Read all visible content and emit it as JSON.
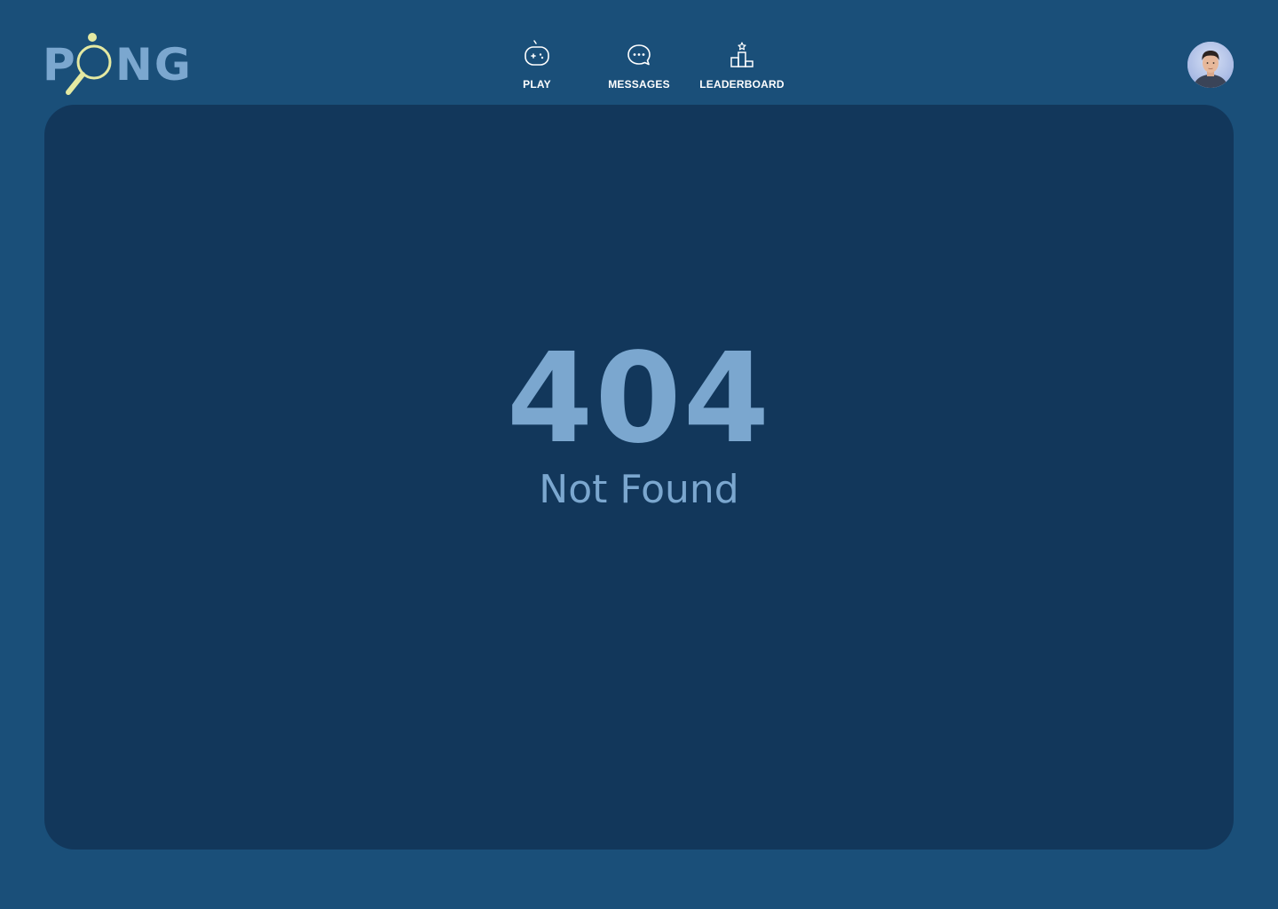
{
  "brand": {
    "logo_left": "P",
    "logo_right": "NG",
    "logo_color": "#7ba7cf",
    "paddle_color": "#e4e9a2"
  },
  "nav": {
    "items": [
      {
        "label": "PLAY",
        "icon": "gamepad-icon"
      },
      {
        "label": "MESSAGES",
        "icon": "chat-bubble-icon"
      },
      {
        "label": "LEADERBOARD",
        "icon": "podium-icon"
      }
    ]
  },
  "user": {
    "avatar": "avatar-icon"
  },
  "error": {
    "code": "404",
    "message": "Not Found"
  },
  "colors": {
    "background": "#1a4f79",
    "panel": "#12375b",
    "text_accent": "#7ba7cf",
    "nav_text": "#ffffff"
  }
}
